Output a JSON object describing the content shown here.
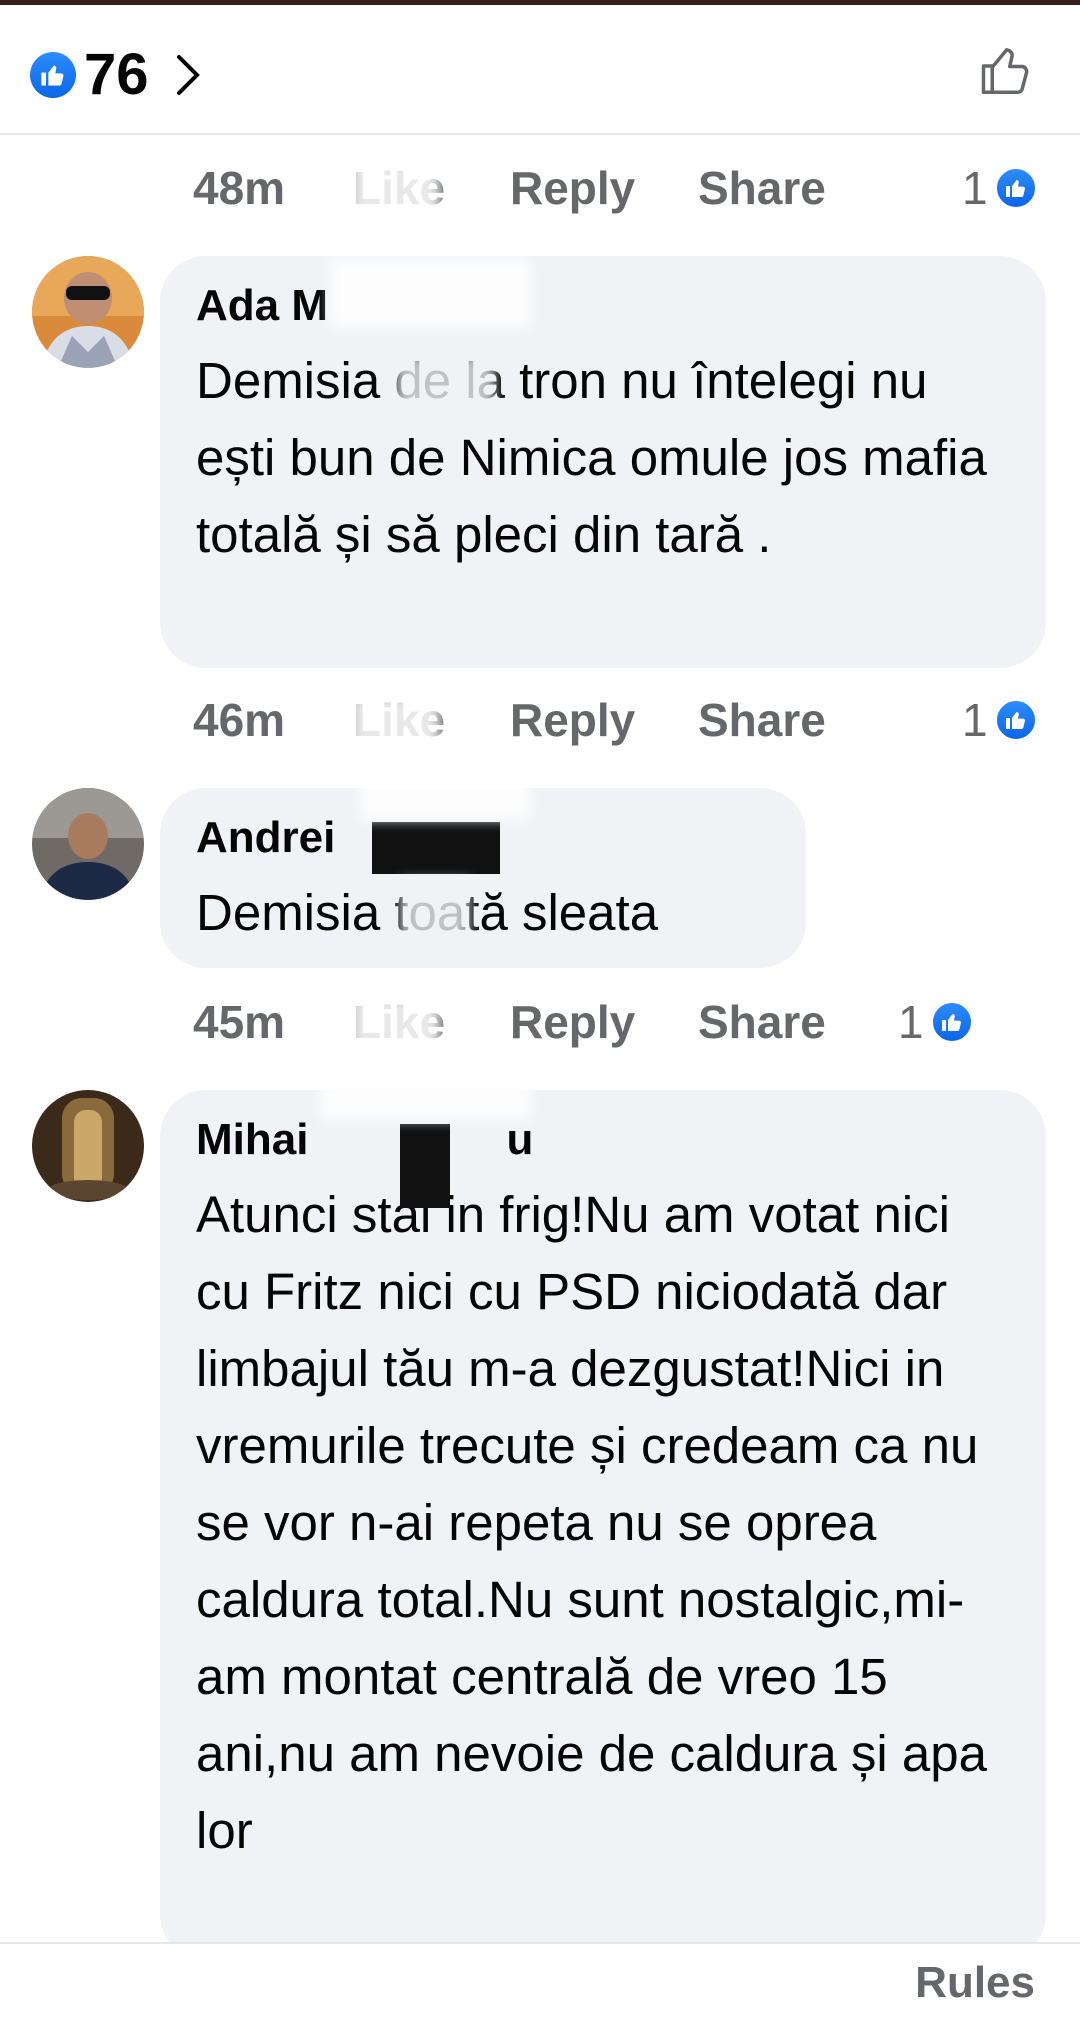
{
  "header": {
    "reaction_count": "76",
    "like_icon": "like-icon",
    "chevron_icon": "chevron-right-icon",
    "thumb_icon": "thumbs-up-outline-icon"
  },
  "actions": {
    "like": "Like",
    "reply": "Reply",
    "share": "Share"
  },
  "comments": [
    {
      "time": "48m",
      "reactions": "1"
    },
    {
      "author": "Ada M",
      "text": "Demisia de la tron nu întelegi nu ești bun de Nimica omule jos mafia totală și să pleci din tară .",
      "time": "46m",
      "reactions": "1"
    },
    {
      "author": "Andrei",
      "text": "Demisia toată sleata",
      "time": "45m",
      "reactions": "1"
    },
    {
      "author": "Mihai",
      "author_suffix": "u",
      "text": "Atunci stai in frig!Nu am votat nici cu Fritz nici cu PSD niciodată dar limbajul tău m-a dezgustat!Nici in vremurile trecute și credeam ca nu se vor n-ai repeta nu se oprea caldura total.Nu sunt nostalgic,mi-am montat centrală de vreo 15 ani,nu am nevoie de caldura și apa lor"
    }
  ],
  "footer": {
    "rules": "Rules"
  },
  "colors": {
    "like_blue": "#1877f2",
    "bubble_bg": "#f0f2f5",
    "meta_gray": "#65676b",
    "text": "#050505"
  }
}
